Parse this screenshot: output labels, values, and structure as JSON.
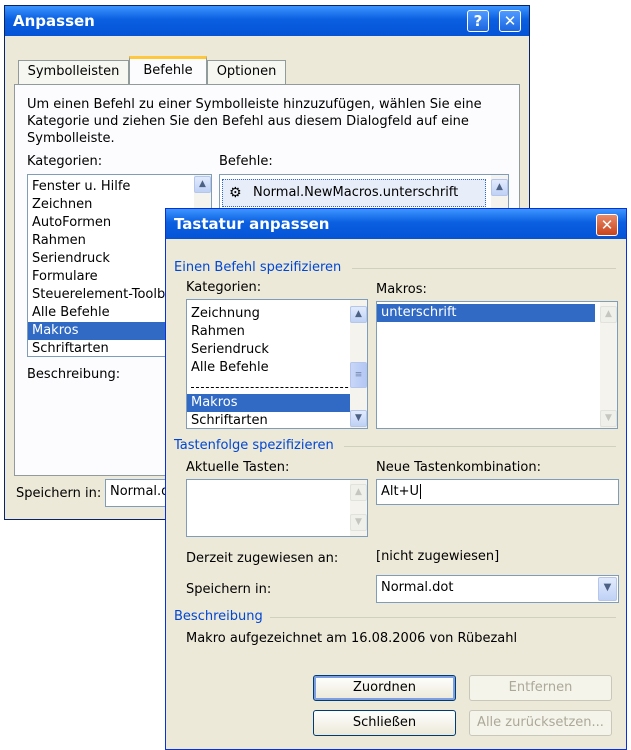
{
  "back_dialog": {
    "title": "Anpassen",
    "help_button": "?",
    "close_button": "✕",
    "tabs": [
      "Symbolleisten",
      "Befehle",
      "Optionen"
    ],
    "instructions": "Um einen Befehl zu einer Symbolleiste hinzuzufügen, wählen Sie eine Kategorie und ziehen Sie den Befehl aus diesem Dialogfeld auf eine Symbolleiste.",
    "categories_label": "Kategorien:",
    "commands_label": "Befehle:",
    "categories": [
      "Fenster u. Hilfe",
      "Zeichnen",
      "AutoFormen",
      "Rahmen",
      "Seriendruck",
      "Formulare",
      "Steuerelement-Toolbox",
      "Alle Befehle",
      "Makros",
      "Schriftarten"
    ],
    "selected_category": "Makros",
    "commands": [
      "Normal.NewMacros.unterschrift"
    ],
    "description_label": "Beschreibung:",
    "save_in_label": "Speichern in:",
    "save_in_value": "Normal.dot"
  },
  "front_dialog": {
    "title": "Tastatur anpassen",
    "close_button": "✕",
    "group_command": "Einen Befehl spezifizieren",
    "categories_label": "Kategorien:",
    "categories": [
      "Zeichnung",
      "Rahmen",
      "Seriendruck",
      "Alle Befehle",
      "Makros",
      "Schriftarten"
    ],
    "selected_category": "Makros",
    "macros_label": "Makros:",
    "macros": [
      "unterschrift"
    ],
    "selected_macro": "unterschrift",
    "group_keys": "Tastenfolge spezifizieren",
    "current_keys_label": "Aktuelle Tasten:",
    "new_key_label": "Neue Tastenkombination:",
    "new_key_value": "Alt+U",
    "assigned_to_label": "Derzeit zugewiesen an:",
    "assigned_to_value": "[nicht zugewiesen]",
    "save_in_label": "Speichern in:",
    "save_in_value": "Normal.dot",
    "group_description": "Beschreibung",
    "description_text": "Makro aufgezeichnet am 16.08.2006 von Rübezahl",
    "buttons": {
      "assign": "Zuordnen",
      "remove": "Entfernen",
      "close": "Schließen",
      "reset_all": "Alle zurücksetzen..."
    }
  }
}
